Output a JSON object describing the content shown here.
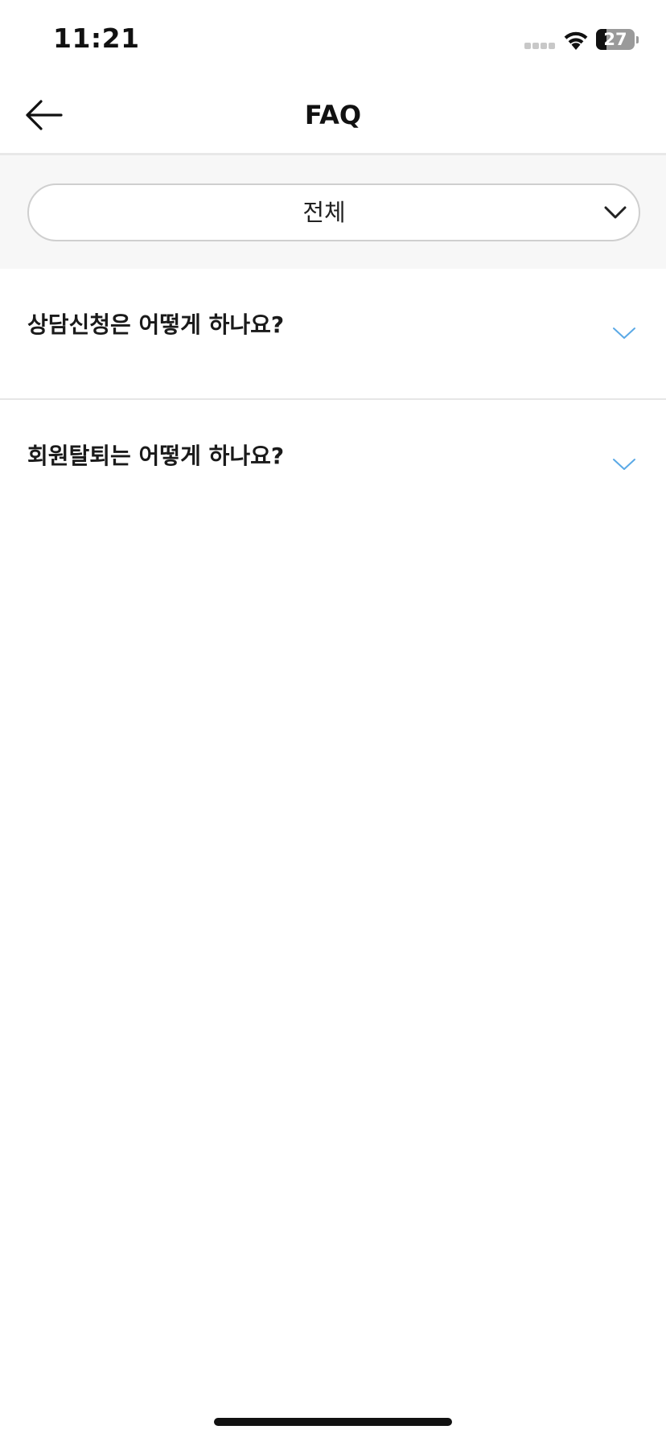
{
  "status_bar": {
    "time": "11:21",
    "battery_level": "27",
    "battery_fraction": 0.27
  },
  "nav": {
    "title": "FAQ",
    "back_icon": "arrow-left-icon"
  },
  "filter": {
    "selected": "전체",
    "icon": "chevron-down-icon"
  },
  "faq": {
    "items": [
      {
        "question": "상담신청은 어떻게 하나요?",
        "icon": "chevron-down-icon",
        "expanded": false
      },
      {
        "question": "회원탈퇴는 어떻게 하나요?",
        "icon": "chevron-down-icon",
        "expanded": false
      }
    ]
  },
  "colors": {
    "accent_chevron": "#5aa9e6",
    "filter_background": "#f7f7f7",
    "divider": "#e6e6e6",
    "text_primary": "#1a1a1a"
  }
}
